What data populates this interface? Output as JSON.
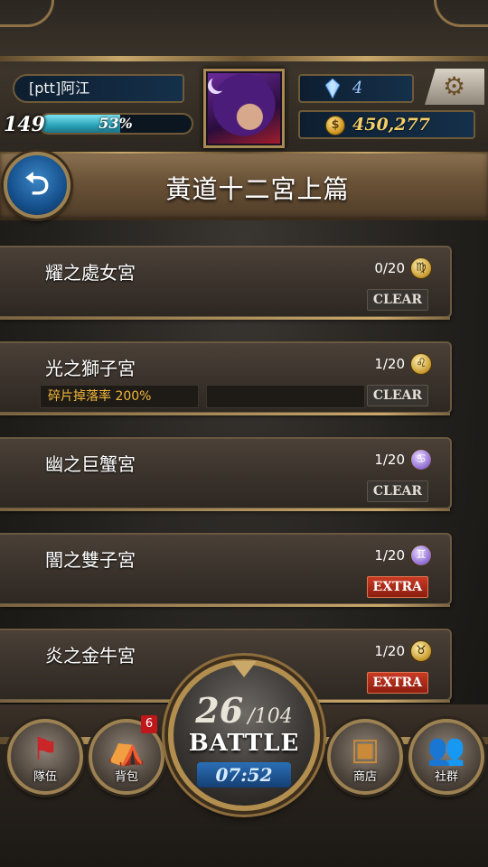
{
  "header": {
    "player_name": "[ptt]阿江",
    "level": "149",
    "exp_percent_label": "53%",
    "exp_fraction": 0.53,
    "crystals": "4",
    "gold": "450,277"
  },
  "page": {
    "title": "黃道十二宮上篇"
  },
  "stages": [
    {
      "name": "耀之處女宮",
      "progress": "0/20",
      "zodiac_icon": "virgo-icon",
      "zodiac_glyph": "♍",
      "tag": "CLEAR",
      "tag_type": "clear",
      "bonus": ""
    },
    {
      "name": "光之獅子宮",
      "progress": "1/20",
      "zodiac_icon": "leo-icon",
      "zodiac_glyph": "♌",
      "tag": "CLEAR",
      "tag_type": "clear",
      "bonus": "碎片掉落率 200%"
    },
    {
      "name": "幽之巨蟹宮",
      "progress": "1/20",
      "zodiac_icon": "cancer-icon",
      "zodiac_glyph": "♋",
      "tag": "CLEAR",
      "tag_type": "clear",
      "bonus": ""
    },
    {
      "name": "闇之雙子宮",
      "progress": "1/20",
      "zodiac_icon": "gemini-icon",
      "zodiac_glyph": "♊",
      "tag": "EXTRA",
      "tag_type": "extra",
      "bonus": ""
    },
    {
      "name": "炎之金牛宮",
      "progress": "1/20",
      "zodiac_icon": "taurus-icon",
      "zodiac_glyph": "♉",
      "tag": "EXTRA",
      "tag_type": "extra",
      "bonus": ""
    }
  ],
  "battle": {
    "current": "26",
    "max": "/104",
    "label": "BATTLE",
    "timer": "07:52"
  },
  "nav": {
    "team_label": "隊伍",
    "bag_label": "背包",
    "bag_badge": "6",
    "shop_label": "商店",
    "social_label": "社群"
  },
  "colors": {
    "accent_gold": "#c9a86a",
    "clear_tag": "#393530",
    "extra_tag": "#c83a24",
    "bonus_text": "#f1b63a"
  }
}
